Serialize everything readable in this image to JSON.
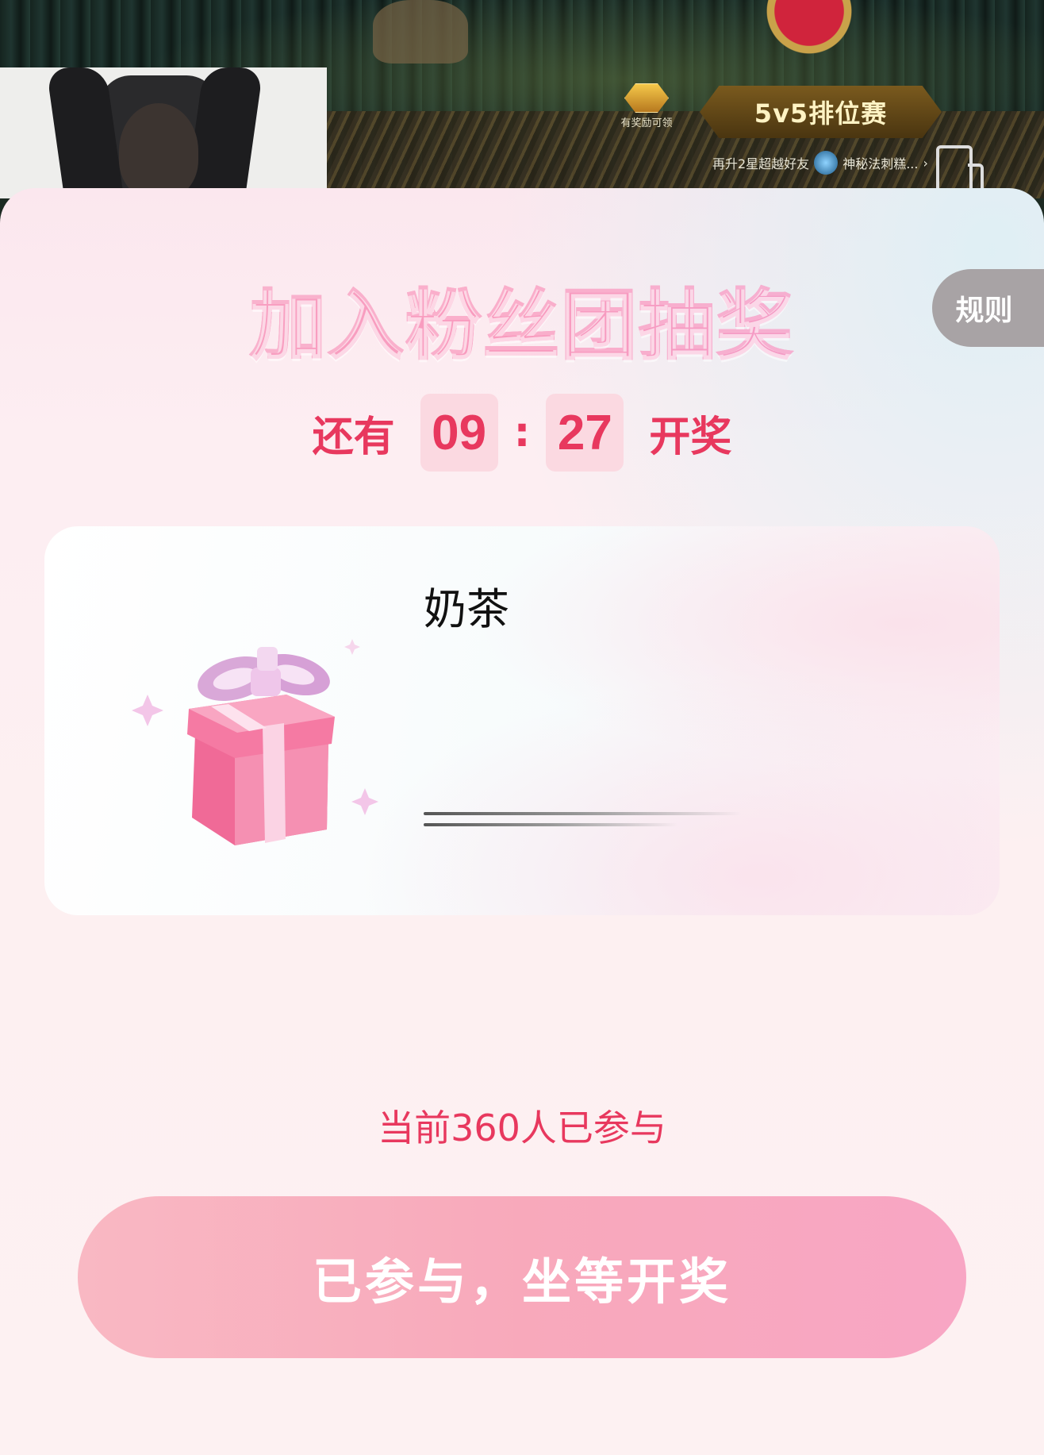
{
  "stream": {
    "reward_label": "有奖励可领",
    "rank_title": "5v5排位赛",
    "rank_subtitle_left": "再升2星超越好友",
    "rank_subtitle_right": "神秘法刺糕...",
    "rank_chevron": "›"
  },
  "lottery": {
    "title": "加入粉丝团抽奖",
    "rules_label": "规则",
    "countdown": {
      "prefix": "还有",
      "minutes": "09",
      "separator": ":",
      "seconds": "27",
      "suffix": "开奖"
    },
    "prize": {
      "name": "奶茶",
      "icon": "gift-box-icon"
    },
    "participants_text": "当前360人已参与",
    "join_button_label": "已参与，坐等开奖"
  },
  "colors": {
    "accent": "#e8385e",
    "title_pink": "#f2357c",
    "button_pink": "#f8a9bb",
    "rules_bg": "#a8a3a5"
  }
}
